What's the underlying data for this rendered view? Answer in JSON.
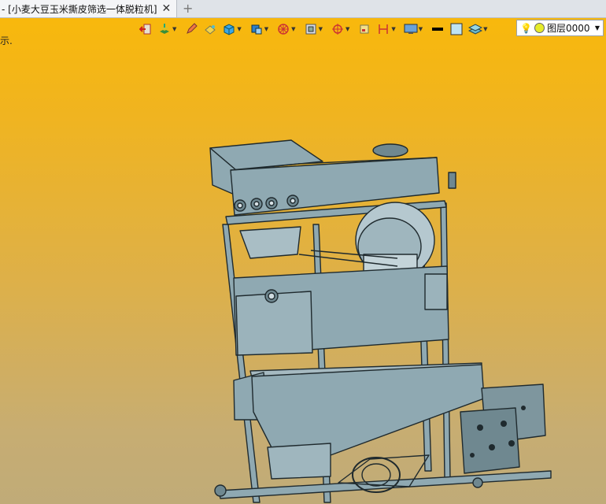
{
  "tab": {
    "title": "- [小麦大豆玉米撕皮筛选一体脱粒机]",
    "close_glyph": "✕",
    "add_glyph": "+"
  },
  "viewport": {
    "status_text": "示."
  },
  "toolbar": {
    "icons": [
      "exit-icon",
      "layer-icon",
      "pencil-icon",
      "paint-bucket-icon",
      "cube-icon",
      "view-cube-icon",
      "wheel-icon",
      "frame-icon",
      "target-icon",
      "rect-icon",
      "dimension-icon",
      "monitor-icon",
      "line-color-icon",
      "fill-color-icon",
      "stack-icon"
    ],
    "layer_name": "图层0000",
    "line_color": "#000000",
    "fill_color": "#bfe3f2"
  },
  "model": {
    "body_color": "#8fa9b2",
    "edge_color": "#1f2a2e"
  }
}
